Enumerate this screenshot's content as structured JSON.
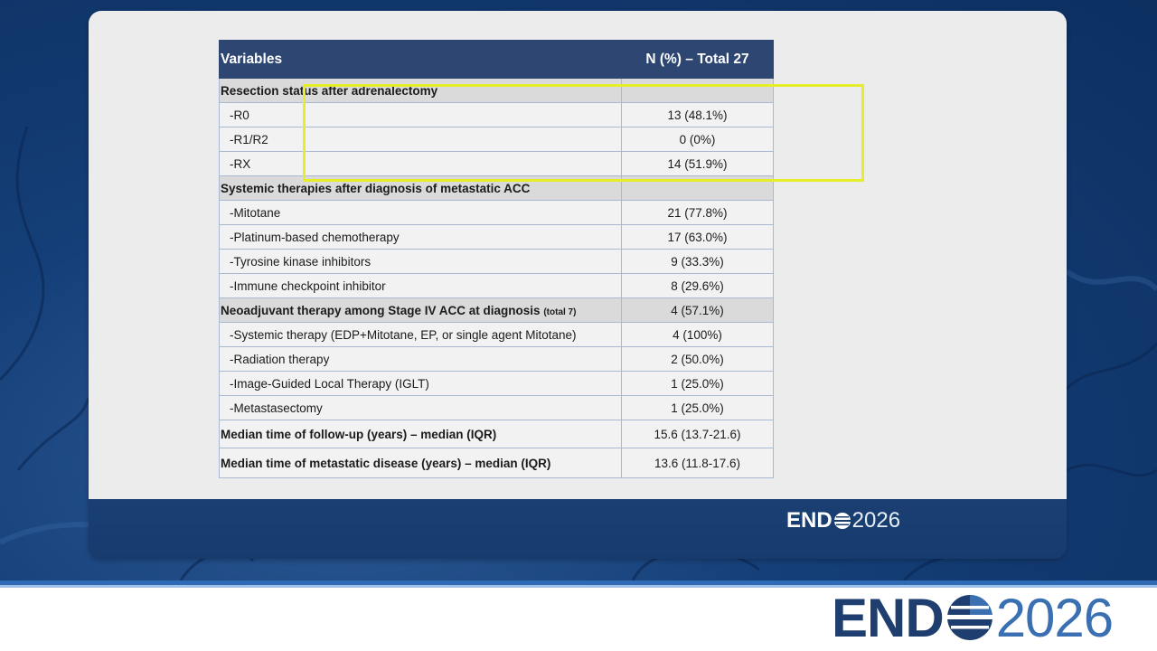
{
  "table": {
    "header": {
      "variables": "Variables",
      "value": "N (%) – Total 27"
    },
    "rows": [
      {
        "type": "section",
        "label": "Resection status after adrenalectomy",
        "value": ""
      },
      {
        "type": "item",
        "label": "-R0",
        "value": "13 (48.1%)"
      },
      {
        "type": "item",
        "label": "-R1/R2",
        "value": "0 (0%)"
      },
      {
        "type": "item",
        "label": "-RX",
        "value": "14 (51.9%)"
      },
      {
        "type": "section",
        "label": "Systemic therapies after diagnosis of metastatic ACC",
        "value": ""
      },
      {
        "type": "item",
        "label": "-Mitotane",
        "value": "21 (77.8%)"
      },
      {
        "type": "item",
        "label": "-Platinum-based chemotherapy",
        "value": "17 (63.0%)"
      },
      {
        "type": "item",
        "label": "-Tyrosine kinase inhibitors",
        "value": "9 (33.3%)"
      },
      {
        "type": "item",
        "label": "-Immune checkpoint inhibitor",
        "value": "8 (29.6%)"
      },
      {
        "type": "section",
        "label": "Neoadjuvant therapy among Stage IV ACC at diagnosis",
        "note": "(total 7)",
        "value": "4 (57.1%)"
      },
      {
        "type": "item",
        "label": "-Systemic therapy (EDP+Mitotane, EP, or single agent Mitotane)",
        "value": "4 (100%)"
      },
      {
        "type": "item",
        "label": "-Radiation therapy",
        "value": "2 (50.0%)"
      },
      {
        "type": "item",
        "label": "-Image-Guided Local Therapy (IGLT)",
        "value": "1 (25.0%)"
      },
      {
        "type": "item",
        "label": "-Metastasectomy",
        "value": "1 (25.0%)"
      },
      {
        "type": "summary",
        "label": "Median time of follow-up (years) – median (IQR)",
        "value": "15.6 (13.7-21.6)"
      },
      {
        "type": "summary",
        "label": "Median time of metastatic disease (years) – median (IQR)",
        "value": "13.6 (11.8-17.6)"
      }
    ]
  },
  "logo": {
    "bold": "END",
    "light": "2026"
  },
  "colors": {
    "header_bg": "#2e4672",
    "section_bg": "#dadada",
    "highlight": "#e6ee2a",
    "brand_dark": "#1d3e6e",
    "brand_light": "#3a6fb2"
  }
}
